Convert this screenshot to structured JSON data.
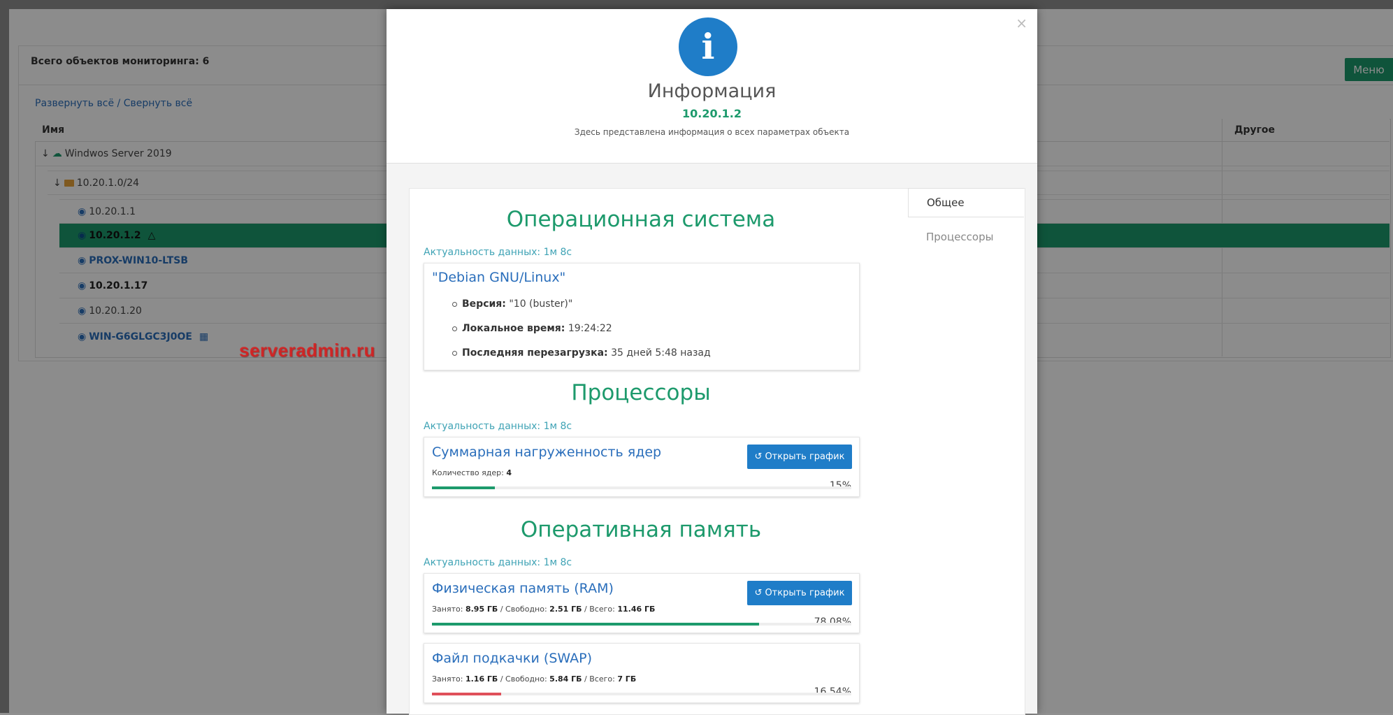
{
  "background": {
    "total_label": "Всего объектов мониторинга: 6",
    "menu_button": "Меню",
    "expand_all": "Развернуть всё",
    "separator": " / ",
    "collapse_all": "Свернуть всё",
    "columns": {
      "name": "Имя",
      "other": "Другое"
    },
    "tree": [
      {
        "label": "Windwos Server 2019",
        "icon": "cloud-icon"
      },
      {
        "label": "10.20.1.0/24",
        "icon": "folder-icon"
      },
      {
        "label": "10.20.1.1",
        "icon": "cube-icon"
      },
      {
        "label": "10.20.1.2",
        "icon": "cube-icon",
        "os_icon": "linux-icon"
      },
      {
        "label": "PROX-WIN10-LTSB",
        "icon": "cube-icon"
      },
      {
        "label": "10.20.1.17",
        "icon": "cube-icon"
      },
      {
        "label": "10.20.1.20",
        "icon": "cube-icon"
      },
      {
        "label": "WIN-G6GLGC3J0OE",
        "icon": "cube-icon",
        "os_icon": "windows-icon"
      }
    ],
    "colors": {
      "accent": "#1d9a6c",
      "link": "#2a6ebb"
    }
  },
  "modal": {
    "title": "Информация",
    "ip": "10.20.1.2",
    "description": "Здесь представлена информация о всех параметрах объекта",
    "tabs": {
      "general": "Общее",
      "cpu": "Процессоры"
    },
    "os": {
      "title": "Операционная система",
      "freshness_label": "Актуальность данных:",
      "freshness_value": "1м 8с",
      "name": "\"Debian GNU/Linux\"",
      "version_label": "Версия:",
      "version_value": "\"10 (buster)\"",
      "time_label": "Локальное время:",
      "time_value": "19:24:22",
      "reboot_label": "Последняя перезагрузка:",
      "reboot_value": "35 дней 5:48 назад"
    },
    "cpu": {
      "title": "Процессоры",
      "freshness_label": "Актуальность данных:",
      "freshness_value": "1м 8с",
      "card_title": "Суммарная нагруженность ядер",
      "cores_label": "Количество ядер:",
      "cores_value": "4",
      "button": "Открыть график",
      "percent": 15,
      "percent_text": "15%"
    },
    "ram": {
      "title": "Оперативная память",
      "freshness_label": "Актуальность данных:",
      "freshness_value": "1м 8с",
      "physical": {
        "title": "Физическая память (RAM)",
        "used_label": "Занято:",
        "used": "8.95 ГБ",
        "free_label": "Свободно:",
        "free": "2.51 ГБ",
        "total_label": "Всего:",
        "total": "11.46 ГБ",
        "button": "Открыть график",
        "percent": 78.08,
        "percent_text": "78.08%"
      },
      "swap": {
        "title": "Файл подкачки (SWAP)",
        "used_label": "Занято:",
        "used": "1.16 ГБ",
        "free_label": "Свободно:",
        "free": "5.84 ГБ",
        "total_label": "Всего:",
        "total": "7 ГБ",
        "percent": 16.54,
        "percent_text": "16.54%"
      }
    },
    "colors": {
      "info": "#1f7dc8",
      "bar_green": "#1d9a6c",
      "bar_red": "#e0505a"
    }
  },
  "watermark": "serveradmin.ru"
}
